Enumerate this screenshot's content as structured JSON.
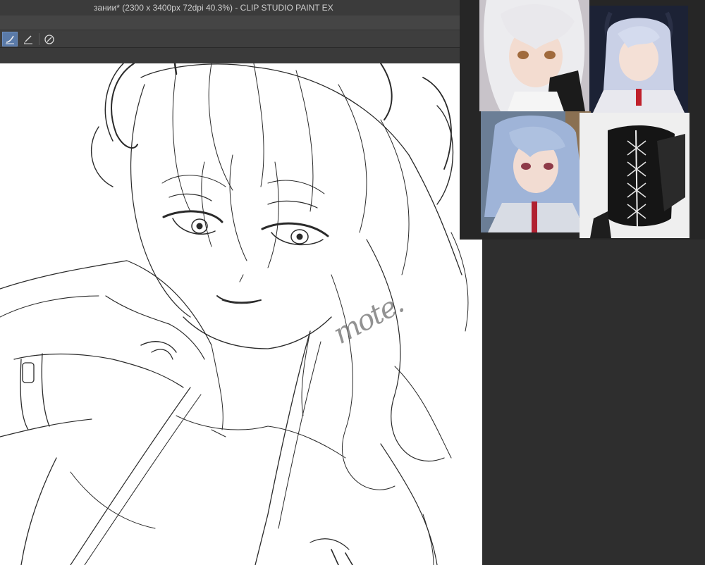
{
  "window": {
    "title": "зании* (2300 x 3400px 72dpi 40.3%)  - CLIP STUDIO PAINT EX"
  },
  "toolbar": {
    "tools": [
      {
        "name": "pen-tool-icon",
        "active": true
      },
      {
        "name": "ruler-pen-icon",
        "active": false
      },
      {
        "name": "stabilization-icon",
        "active": false
      }
    ]
  },
  "canvas": {
    "watermark_text": "mote.",
    "background": "#ffffff",
    "line_color": "#2a2a2a"
  },
  "reference_panel": {
    "images": [
      {
        "name": "reference-silver-hair-portrait",
        "hair": "#e4e2e6",
        "bg": "#bdb8bf"
      },
      {
        "name": "reference-horned-chibi",
        "hair": "#c9d0e6",
        "bg": "#1c2235"
      },
      {
        "name": "reference-blue-hair-portrait",
        "hair": "#9fb4d8",
        "bg": "#5a6f8c"
      },
      {
        "name": "reference-corset",
        "hair": "#111111",
        "bg": "#f2f2f2"
      }
    ]
  },
  "colors": {
    "ui_dark": "#2b2b2b",
    "titlebar": "#3b3b3b",
    "accent": "#5a7aa8"
  }
}
